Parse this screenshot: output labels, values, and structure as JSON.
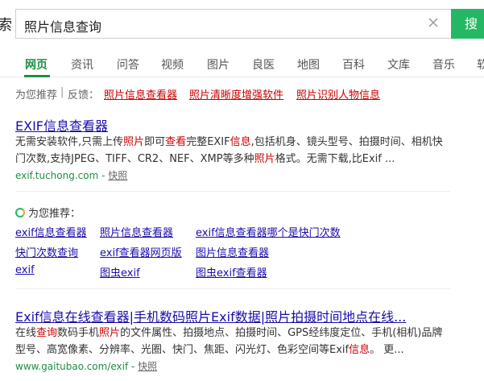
{
  "search": {
    "logo_fragment": "索",
    "query": "照片信息查询",
    "button_label": "搜"
  },
  "nav": {
    "items": [
      "网页",
      "资讯",
      "问答",
      "视频",
      "图片",
      "良医",
      "地图",
      "百科",
      "文库",
      "音乐",
      "软"
    ],
    "active": "网页"
  },
  "recommend": {
    "label": "为您推荐",
    "sep": "|",
    "feedback": "反馈：",
    "links": [
      "照片信息查看器",
      "照片清晰度增强软件",
      "照片识别人物信息"
    ]
  },
  "result1": {
    "title": "EXIF信息查看器",
    "desc_line1": [
      "无需安装软件,只需上传",
      "照片",
      "即可",
      "查看",
      "完整EXIF",
      "信息",
      ",包括机身、镜头型号、拍摄时间、相机快"
    ],
    "desc_line2": [
      "门次数,支持JPEG、TIFF、CR2、NEF、XMP等多种",
      "照片",
      "格式。无需下载,比Exif ..."
    ],
    "url": "exif.tuchong.com",
    "url_sep": " - ",
    "snapshot": "快照"
  },
  "related": {
    "heading": "为您推荐：",
    "links": [
      [
        "exif信息查看器",
        "照片信息查看器",
        "exif信息查看器哪个是快门次数"
      ],
      [
        "快门次数查询",
        "exif查看器网页版",
        "图片信息查看器"
      ],
      [
        "exif",
        "图虫exif",
        "图虫exif查看器"
      ]
    ]
  },
  "result2": {
    "title": "Exif信息在线查看器|手机数码照片Exif数据|照片拍摄时间地点在线...",
    "desc_line1": [
      "在线",
      "查询",
      "数码手机",
      "照片",
      "的文件属性、拍摄地点、拍摄时间、GPS经纬度定位、手机(相机)品牌"
    ],
    "desc_line2": [
      "型号、高宽像素、分辨率、光圈、快门、焦距、闪光灯、色彩空间等Exif",
      "信息",
      "。 更..."
    ],
    "url": "www.gaitubao.com/exif",
    "url_sep": " - ",
    "snapshot": "快照"
  },
  "colors": {
    "brand_green": "#25b864",
    "link_blue": "#1a0dab",
    "highlight_red": "#cc0000",
    "url_green": "#1e8f43"
  }
}
